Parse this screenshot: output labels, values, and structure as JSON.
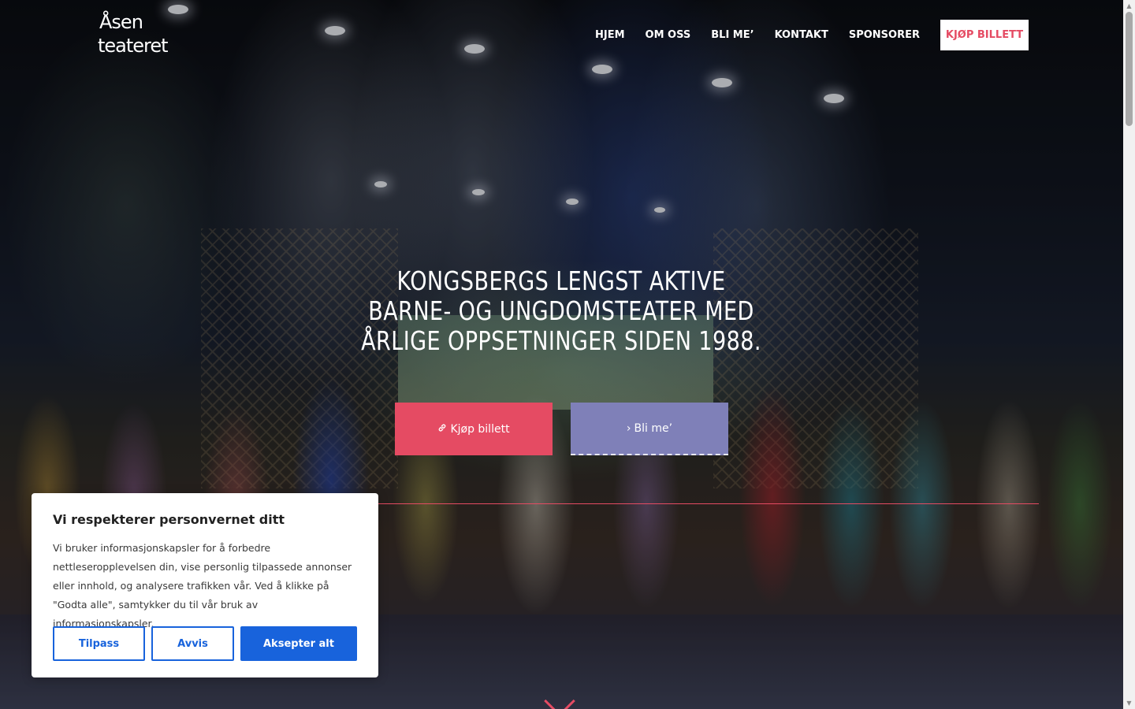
{
  "logo": {
    "line1": "Åsen",
    "line2": "teateret"
  },
  "nav": {
    "items": [
      {
        "label": "HJEM"
      },
      {
        "label": "OM OSS"
      },
      {
        "label": "BLI ME’"
      },
      {
        "label": "KONTAKT"
      },
      {
        "label": "SPONSORER"
      }
    ],
    "cta_label": "KJØP BILLETT"
  },
  "hero": {
    "headline": "KONGSBERGS LENGST AKTIVE BARNE- OG UNGDOMSTEATER MED ÅRLIGE OPPSETNINGER SIDEN 1988.",
    "buttons": {
      "ticket_label": "Kjøp billett",
      "ticket_icon": "link-icon",
      "join_label": "Bli me’",
      "join_icon": "chevron-right-icon"
    },
    "scroll_icon": "chevron-down-icon"
  },
  "cookie_banner": {
    "title": "Vi respekterer personvernet ditt",
    "text": "Vi bruker informasjonskapsler for å forbedre nettleseropplevelsen din, vise personlig tilpassede annonser eller innhold, og analysere trafikken vår. Ved å klikke på \"Godta alle\", samtykker du til vår bruk av informasjonskapsler.",
    "customize_label": "Tilpass",
    "reject_label": "Avvis",
    "accept_label": "Aksepter alt"
  },
  "colors": {
    "accent": "#e54b63",
    "join_button": "#7f80b8",
    "cookie_primary": "#1863dc"
  }
}
